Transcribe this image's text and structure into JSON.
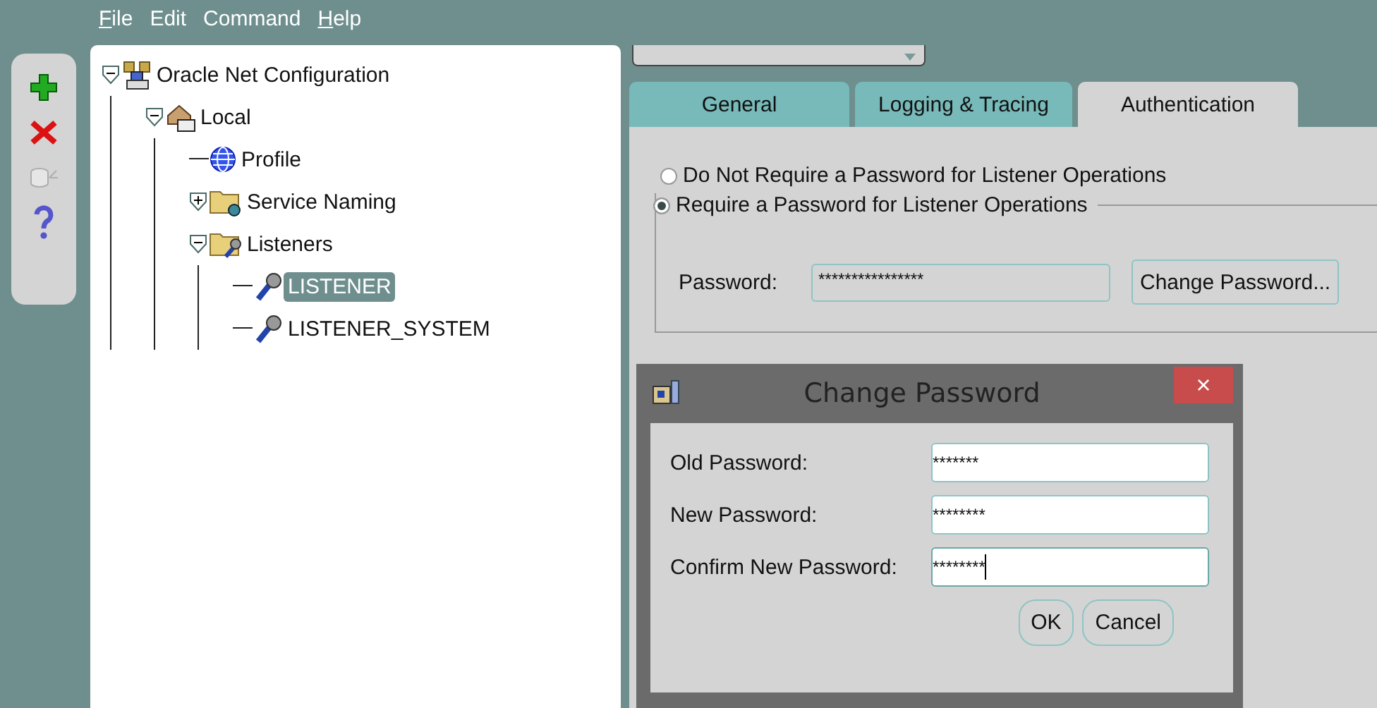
{
  "menu": [
    {
      "label": "File",
      "underline_first": true
    },
    {
      "label": "Edit",
      "underline_first": false
    },
    {
      "label": "Command",
      "underline_first": false
    },
    {
      "label": "Help",
      "underline_first": true
    }
  ],
  "toolbar": [
    {
      "kind": "add",
      "disabled": false
    },
    {
      "kind": "remove",
      "disabled": false
    },
    {
      "kind": "database",
      "disabled": true
    },
    {
      "kind": "help",
      "disabled": false
    }
  ],
  "tree": [
    {
      "label": "Oracle Net Configuration",
      "kind": "network",
      "expanded": true,
      "selected": false,
      "children": [
        {
          "label": "Local",
          "kind": "house",
          "expanded": true,
          "selected": false,
          "children": [
            {
              "label": "Profile",
              "kind": "globe",
              "selected": false
            },
            {
              "label": "Service Naming",
              "kind": "folder",
              "expanded": false,
              "selected": false
            },
            {
              "label": "Listeners",
              "kind": "folder-listener",
              "expanded": true,
              "selected": false,
              "children": [
                {
                  "label": "LISTENER",
                  "kind": "listener",
                  "selected": true
                },
                {
                  "label": "LISTENER_SYSTEM",
                  "kind": "listener",
                  "selected": false
                }
              ]
            }
          ]
        }
      ]
    }
  ],
  "tabs": [
    {
      "label": "General",
      "selected": false
    },
    {
      "label": "Logging & Tracing",
      "selected": false
    },
    {
      "label": "Authentication",
      "selected": true
    }
  ],
  "radios": [
    {
      "label": "Do Not Require a Password for Listener Operations",
      "selected": false
    },
    {
      "label": "Require a Password for Listener Operations",
      "selected": true
    }
  ],
  "password": {
    "label": "Password:",
    "value": "****************",
    "button": "Change Password..."
  },
  "dialog": {
    "title": "Change Password",
    "close": "×",
    "fields": [
      {
        "label": "Old Password:",
        "value": "*******",
        "focused": false
      },
      {
        "label": "New Password:",
        "value": "********",
        "focused": false
      },
      {
        "label": "Confirm New Password:",
        "value": "********",
        "focused": true
      }
    ],
    "buttons": [
      "OK",
      "Cancel"
    ]
  }
}
